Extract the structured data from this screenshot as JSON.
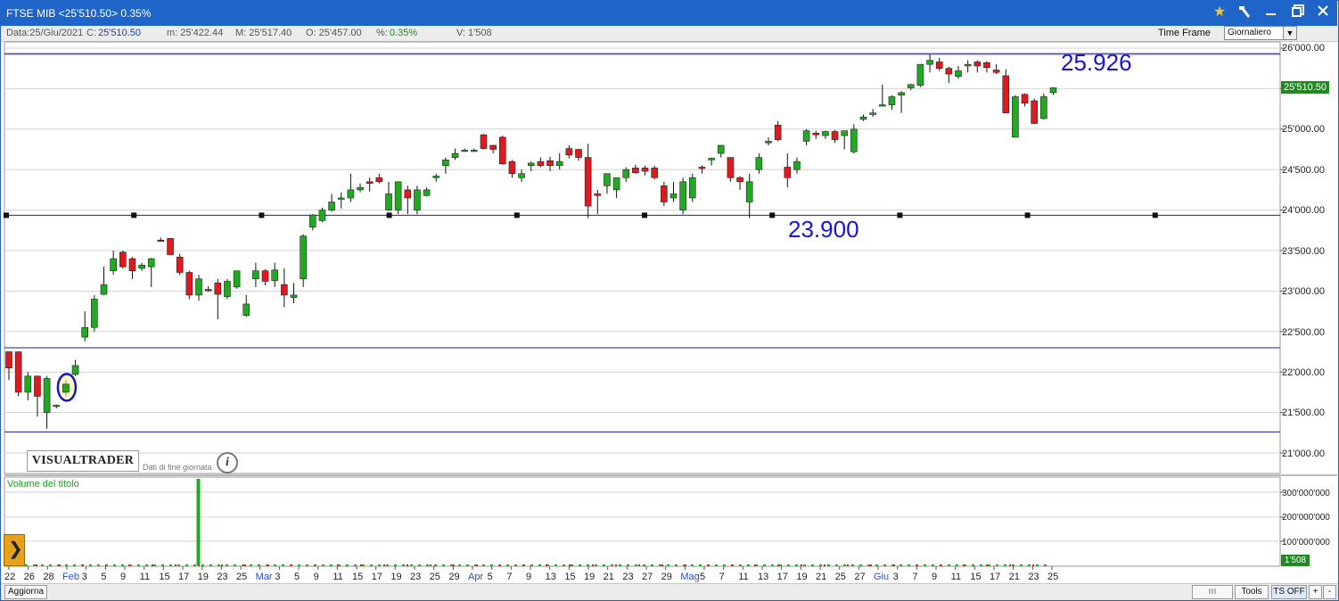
{
  "window": {
    "title": "FTSE MIB <25'510.50> 0.35%",
    "title_bg": "#1f64c8",
    "icons": [
      "star-icon",
      "hammer-icon",
      "minimize-icon",
      "maximize-icon",
      "close-icon"
    ]
  },
  "infobar": {
    "date": "Data:25/Giu/2021",
    "close_label": "C:",
    "close_value": "25'510.50",
    "min": "m: 25'422.44",
    "max": "M: 25'517.40",
    "open": "O: 25'457.00",
    "pct_label": "%:",
    "pct_value": "0.35%",
    "vol": "V: 1'508",
    "time_frame_label": "Time Frame",
    "time_frame_value": "Giornaliero"
  },
  "annotations": {
    "high": "25.926",
    "support": "23.900"
  },
  "branding": {
    "logo": "VISUALTRADER",
    "eod": "Dati di fine giornata",
    "info": "i"
  },
  "price_axis": {
    "labels": [
      "26'000.00",
      "25'500.00",
      "25'000.00",
      "24'500.00",
      "24'000.00",
      "23'500.00",
      "23'000.00",
      "22'500.00",
      "22'000.00",
      "21'500.00",
      "21'000.00"
    ],
    "last_price": "25'510.50"
  },
  "volume_panel": {
    "label": "Volume del titolo",
    "axis_labels": [
      "300'000'000",
      "200'000'000",
      "100'000'000"
    ],
    "last_volume": "1'508"
  },
  "x_axis": {
    "labels": [
      "22",
      "26",
      "28",
      "Feb",
      "3",
      "5",
      "9",
      "11",
      "15",
      "17",
      "19",
      "23",
      "25",
      "Mar",
      "3",
      "5",
      "9",
      "11",
      "15",
      "17",
      "19",
      "23",
      "25",
      "29",
      "Apr",
      "5",
      "7",
      "9",
      "13",
      "15",
      "19",
      "21",
      "23",
      "27",
      "29",
      "Mag",
      "5",
      "7",
      "11",
      "13",
      "17",
      "19",
      "21",
      "25",
      "27",
      "Giu",
      "3",
      "7",
      "9",
      "11",
      "15",
      "17",
      "21",
      "23",
      "25"
    ],
    "month_labels": [
      "Feb",
      "Mar",
      "Apr",
      "Mag",
      "Giu"
    ]
  },
  "bottombar": {
    "aggiorna": "Aggiorna",
    "tools": "Tools",
    "ts_off": "TS OFF",
    "plus": "+",
    "minus": "-"
  },
  "colors": {
    "up": "#1faa1f",
    "down": "#e0191e",
    "hline": "#1a1aa8",
    "annotation": "#1515d8"
  },
  "chart_data": {
    "type": "candlestick",
    "title": "FTSE MIB",
    "ylim": [
      20800,
      26100
    ],
    "horizontal_lines": [
      25926,
      23936,
      22300,
      21260
    ],
    "candles": [
      {
        "o": 22250,
        "h": 22250,
        "l": 21900,
        "c": 22050
      },
      {
        "o": 22250,
        "h": 22250,
        "l": 21700,
        "c": 21750
      },
      {
        "o": 21750,
        "h": 22000,
        "l": 21650,
        "c": 21950
      },
      {
        "o": 21950,
        "h": 21950,
        "l": 21450,
        "c": 21700
      },
      {
        "o": 21500,
        "h": 21950,
        "l": 21300,
        "c": 21920
      },
      {
        "o": 21580,
        "h": 21600,
        "l": 21550,
        "c": 21590
      },
      {
        "o": 21750,
        "h": 21900,
        "l": 21700,
        "c": 21850
      },
      {
        "o": 21970,
        "h": 22150,
        "l": 21950,
        "c": 22080
      },
      {
        "o": 22430,
        "h": 22750,
        "l": 22380,
        "c": 22550
      },
      {
        "o": 22550,
        "h": 22950,
        "l": 22500,
        "c": 22900
      },
      {
        "o": 22960,
        "h": 23300,
        "l": 22950,
        "c": 23080
      },
      {
        "o": 23250,
        "h": 23500,
        "l": 23200,
        "c": 23400
      },
      {
        "o": 23480,
        "h": 23500,
        "l": 23280,
        "c": 23300
      },
      {
        "o": 23400,
        "h": 23420,
        "l": 23150,
        "c": 23250
      },
      {
        "o": 23280,
        "h": 23350,
        "l": 23250,
        "c": 23320
      },
      {
        "o": 23300,
        "h": 23410,
        "l": 23050,
        "c": 23400
      },
      {
        "o": 23630,
        "h": 23660,
        "l": 23610,
        "c": 23620
      },
      {
        "o": 23650,
        "h": 23650,
        "l": 23450,
        "c": 23450
      },
      {
        "o": 23420,
        "h": 23460,
        "l": 23200,
        "c": 23230
      },
      {
        "o": 23230,
        "h": 23250,
        "l": 22900,
        "c": 22950
      },
      {
        "o": 22950,
        "h": 23200,
        "l": 22880,
        "c": 23150
      },
      {
        "o": 23020,
        "h": 23060,
        "l": 22990,
        "c": 23010
      },
      {
        "o": 23100,
        "h": 23150,
        "l": 22650,
        "c": 22960
      },
      {
        "o": 22930,
        "h": 23150,
        "l": 22900,
        "c": 23120
      },
      {
        "o": 23050,
        "h": 23250,
        "l": 23030,
        "c": 23250
      },
      {
        "o": 22700,
        "h": 22950,
        "l": 22680,
        "c": 22840
      },
      {
        "o": 23150,
        "h": 23350,
        "l": 23050,
        "c": 23250
      },
      {
        "o": 23250,
        "h": 23270,
        "l": 23070,
        "c": 23120
      },
      {
        "o": 23130,
        "h": 23350,
        "l": 23050,
        "c": 23260
      },
      {
        "o": 23080,
        "h": 23280,
        "l": 22800,
        "c": 22950
      },
      {
        "o": 22920,
        "h": 23100,
        "l": 22850,
        "c": 22950
      },
      {
        "o": 23150,
        "h": 23700,
        "l": 23050,
        "c": 23680
      },
      {
        "o": 23790,
        "h": 23950,
        "l": 23750,
        "c": 23940
      },
      {
        "o": 23870,
        "h": 24030,
        "l": 23850,
        "c": 24000
      },
      {
        "o": 24000,
        "h": 24200,
        "l": 23980,
        "c": 24100
      },
      {
        "o": 24150,
        "h": 24220,
        "l": 24020,
        "c": 24150
      },
      {
        "o": 24150,
        "h": 24450,
        "l": 24100,
        "c": 24250
      },
      {
        "o": 24250,
        "h": 24330,
        "l": 24220,
        "c": 24280
      },
      {
        "o": 24350,
        "h": 24400,
        "l": 24230,
        "c": 24330
      },
      {
        "o": 24400,
        "h": 24450,
        "l": 24330,
        "c": 24350
      },
      {
        "o": 24000,
        "h": 24350,
        "l": 23990,
        "c": 24200
      },
      {
        "o": 24000,
        "h": 24350,
        "l": 23950,
        "c": 24350
      },
      {
        "o": 24250,
        "h": 24300,
        "l": 23950,
        "c": 24150
      },
      {
        "o": 24000,
        "h": 24300,
        "l": 23950,
        "c": 24250
      },
      {
        "o": 24180,
        "h": 24280,
        "l": 24170,
        "c": 24250
      },
      {
        "o": 24400,
        "h": 24450,
        "l": 24350,
        "c": 24420
      },
      {
        "o": 24550,
        "h": 24650,
        "l": 24450,
        "c": 24620
      },
      {
        "o": 24650,
        "h": 24760,
        "l": 24620,
        "c": 24700
      },
      {
        "o": 24740,
        "h": 24760,
        "l": 24720,
        "c": 24740
      },
      {
        "o": 24740,
        "h": 24760,
        "l": 24720,
        "c": 24740
      },
      {
        "o": 24930,
        "h": 24940,
        "l": 24750,
        "c": 24760
      },
      {
        "o": 24800,
        "h": 24800,
        "l": 24700,
        "c": 24750
      },
      {
        "o": 24900,
        "h": 24920,
        "l": 24560,
        "c": 24570
      },
      {
        "o": 24600,
        "h": 24620,
        "l": 24400,
        "c": 24450
      },
      {
        "o": 24400,
        "h": 24500,
        "l": 24350,
        "c": 24450
      },
      {
        "o": 24550,
        "h": 24600,
        "l": 24480,
        "c": 24580
      },
      {
        "o": 24600,
        "h": 24650,
        "l": 24530,
        "c": 24550
      },
      {
        "o": 24610,
        "h": 24660,
        "l": 24480,
        "c": 24550
      },
      {
        "o": 24550,
        "h": 24700,
        "l": 24500,
        "c": 24600
      },
      {
        "o": 24760,
        "h": 24800,
        "l": 24640,
        "c": 24680
      },
      {
        "o": 24750,
        "h": 24750,
        "l": 24610,
        "c": 24650
      },
      {
        "o": 24650,
        "h": 24820,
        "l": 23900,
        "c": 24050
      },
      {
        "o": 24200,
        "h": 24250,
        "l": 23950,
        "c": 24180
      },
      {
        "o": 24300,
        "h": 24420,
        "l": 24200,
        "c": 24450
      },
      {
        "o": 24250,
        "h": 24300,
        "l": 24150,
        "c": 24400
      },
      {
        "o": 24400,
        "h": 24530,
        "l": 24350,
        "c": 24500
      },
      {
        "o": 24520,
        "h": 24560,
        "l": 24450,
        "c": 24460
      },
      {
        "o": 24520,
        "h": 24550,
        "l": 24430,
        "c": 24480
      },
      {
        "o": 24520,
        "h": 24550,
        "l": 24380,
        "c": 24400
      },
      {
        "o": 24300,
        "h": 24350,
        "l": 24050,
        "c": 24100
      },
      {
        "o": 24150,
        "h": 24350,
        "l": 24100,
        "c": 24200
      },
      {
        "o": 24000,
        "h": 24400,
        "l": 23950,
        "c": 24350
      },
      {
        "o": 24150,
        "h": 24450,
        "l": 24100,
        "c": 24400
      },
      {
        "o": 24530,
        "h": 24550,
        "l": 24450,
        "c": 24520
      },
      {
        "o": 24620,
        "h": 24650,
        "l": 24550,
        "c": 24640
      },
      {
        "o": 24700,
        "h": 24800,
        "l": 24650,
        "c": 24800
      },
      {
        "o": 24650,
        "h": 24650,
        "l": 24350,
        "c": 24400
      },
      {
        "o": 24400,
        "h": 24420,
        "l": 24250,
        "c": 24350
      },
      {
        "o": 24100,
        "h": 24450,
        "l": 23900,
        "c": 24350
      },
      {
        "o": 24500,
        "h": 24700,
        "l": 24450,
        "c": 24650
      },
      {
        "o": 24830,
        "h": 24900,
        "l": 24800,
        "c": 24850
      },
      {
        "o": 25050,
        "h": 25100,
        "l": 24850,
        "c": 24870
      },
      {
        "o": 24530,
        "h": 24700,
        "l": 24280,
        "c": 24400
      },
      {
        "o": 24500,
        "h": 24650,
        "l": 24450,
        "c": 24600
      },
      {
        "o": 24850,
        "h": 25000,
        "l": 24800,
        "c": 24980
      },
      {
        "o": 24950,
        "h": 24980,
        "l": 24880,
        "c": 24930
      },
      {
        "o": 24920,
        "h": 24980,
        "l": 24880,
        "c": 24970
      },
      {
        "o": 24970,
        "h": 24990,
        "l": 24830,
        "c": 24870
      },
      {
        "o": 24920,
        "h": 24950,
        "l": 24750,
        "c": 24980
      },
      {
        "o": 24720,
        "h": 25060,
        "l": 24700,
        "c": 25000
      },
      {
        "o": 25120,
        "h": 25180,
        "l": 25100,
        "c": 25150
      },
      {
        "o": 25180,
        "h": 25250,
        "l": 25150,
        "c": 25200
      },
      {
        "o": 25300,
        "h": 25550,
        "l": 25280,
        "c": 25300
      },
      {
        "o": 25300,
        "h": 25420,
        "l": 25240,
        "c": 25400
      },
      {
        "o": 25420,
        "h": 25470,
        "l": 25200,
        "c": 25450
      },
      {
        "o": 25510,
        "h": 25560,
        "l": 25480,
        "c": 25550
      },
      {
        "o": 25540,
        "h": 25800,
        "l": 25520,
        "c": 25800
      },
      {
        "o": 25800,
        "h": 25926,
        "l": 25700,
        "c": 25850
      },
      {
        "o": 25830,
        "h": 25880,
        "l": 25720,
        "c": 25750
      },
      {
        "o": 25750,
        "h": 25770,
        "l": 25570,
        "c": 25680
      },
      {
        "o": 25650,
        "h": 25780,
        "l": 25620,
        "c": 25720
      },
      {
        "o": 25780,
        "h": 25850,
        "l": 25700,
        "c": 25800
      },
      {
        "o": 25830,
        "h": 25850,
        "l": 25700,
        "c": 25780
      },
      {
        "o": 25820,
        "h": 25840,
        "l": 25700,
        "c": 25760
      },
      {
        "o": 25730,
        "h": 25800,
        "l": 25680,
        "c": 25700
      },
      {
        "o": 25660,
        "h": 25740,
        "l": 25200,
        "c": 25200
      },
      {
        "o": 24900,
        "h": 25420,
        "l": 24900,
        "c": 25400
      },
      {
        "o": 25430,
        "h": 25440,
        "l": 25280,
        "c": 25320
      },
      {
        "o": 25350,
        "h": 25380,
        "l": 25060,
        "c": 25070
      },
      {
        "o": 25130,
        "h": 25440,
        "l": 25120,
        "c": 25400
      },
      {
        "o": 25450,
        "h": 25517,
        "l": 25422,
        "c": 25510
      }
    ],
    "volume": [
      0,
      0,
      0,
      0,
      0,
      0,
      0,
      0,
      0,
      0,
      0,
      0,
      0,
      0,
      0,
      0,
      0,
      0,
      0,
      0,
      0,
      0,
      0,
      0,
      0,
      0,
      0,
      0,
      0,
      0,
      0,
      0,
      0,
      0,
      0,
      0,
      0,
      0,
      0,
      0,
      0,
      0,
      0,
      0,
      0,
      0,
      0,
      0,
      0,
      0,
      0,
      0,
      0,
      0,
      0,
      0,
      0,
      0,
      0,
      0,
      0,
      0,
      0,
      0,
      0,
      0,
      0,
      0,
      0,
      0,
      0,
      0,
      0,
      0,
      0,
      0,
      0,
      0,
      0,
      0,
      0,
      0,
      0,
      0,
      0,
      0,
      0,
      0,
      0,
      0,
      0,
      0,
      0,
      0,
      0,
      0,
      0,
      0,
      0,
      0,
      0,
      0,
      0,
      0,
      0,
      0,
      0,
      0,
      0,
      0,
      0,
      0,
      0
    ],
    "volume_spike": {
      "label": "19",
      "value": 350000000
    }
  }
}
